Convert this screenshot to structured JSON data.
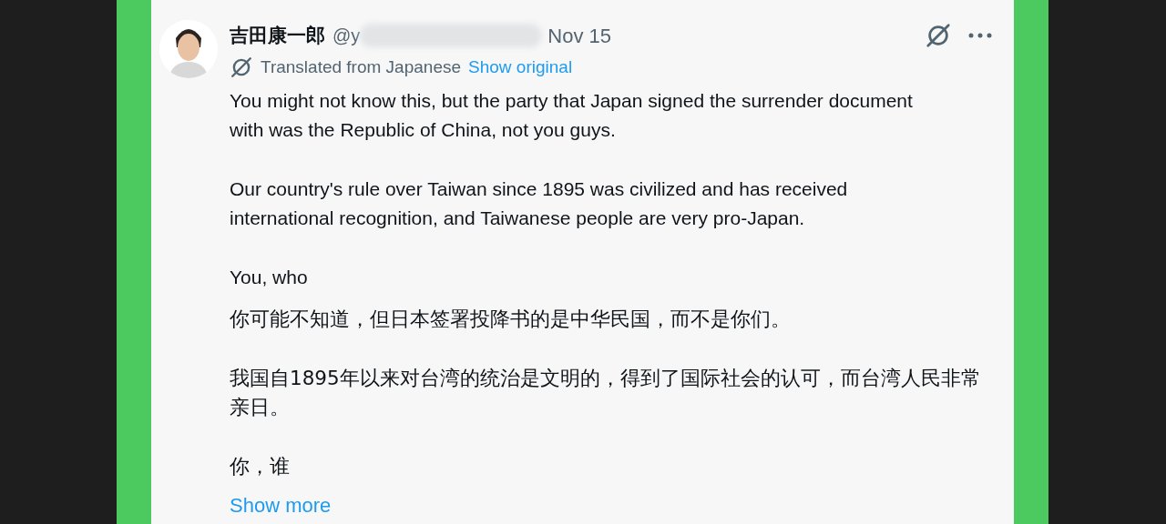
{
  "post": {
    "author": {
      "name": "吉田康一郎",
      "handle": "@y",
      "handle_redacted": true
    },
    "date": "Nov 15",
    "translation": {
      "label": "Translated from Japanese",
      "link": "Show original"
    },
    "paragraphs": [
      {
        "text": "You might not know this, but the party that Japan signed the surrender document with was the Republic of China, not you guys.",
        "kind": "latin"
      },
      {
        "text": "Our country's rule over Taiwan since 1895 was civilized and has received international recognition, and Taiwanese people are very pro-Japan.",
        "kind": "latin"
      },
      {
        "text": "You, who",
        "kind": "latin"
      },
      {
        "text": "你可能不知道，但日本签署投降书的是中华民国，而不是你们。",
        "kind": "cjk"
      },
      {
        "text": "我国自1895年以来对台湾的统治是文明的，得到了国际社会的认可，而台湾人民非常亲日。",
        "kind": "cjk"
      },
      {
        "text": "你，谁",
        "kind": "cjk"
      }
    ],
    "show_more": "Show more"
  }
}
